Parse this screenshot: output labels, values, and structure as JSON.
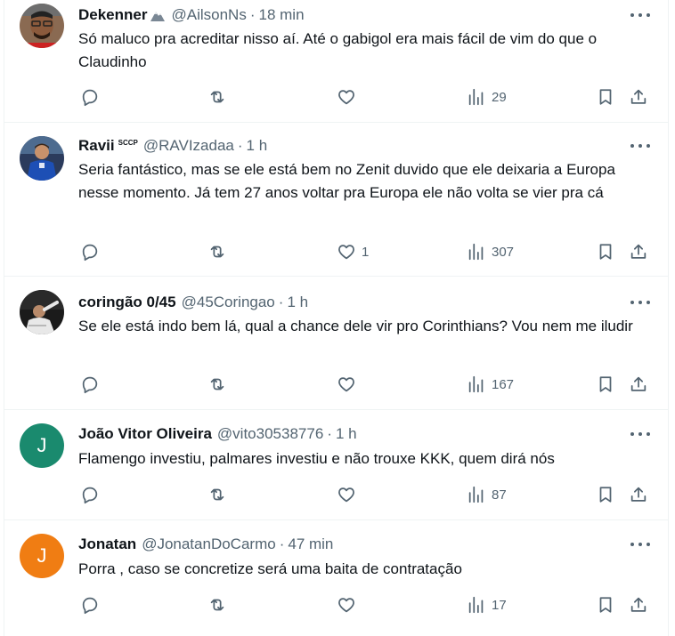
{
  "tweets": [
    {
      "name": "Dekenner",
      "badge": "",
      "handle": "@AilsonNs",
      "separator": "·",
      "time": "18 min",
      "text": "Só maluco pra acreditar nisso aí. Até o gabigol era mais fácil de vim do que o Claudinho",
      "likes": "",
      "views": "29",
      "avatar_letter": ""
    },
    {
      "name": "Ravii",
      "badge": "SCCP",
      "handle": "@RAVIzadaa",
      "separator": "·",
      "time": "1 h",
      "text": "Seria fantástico, mas se ele está bem no Zenit duvido que ele deixaria a Europa nesse momento. Já tem 27 anos voltar pra Europa ele não volta se vier pra cá",
      "likes": "1",
      "views": "307",
      "avatar_letter": ""
    },
    {
      "name": "coringão 0/45",
      "badge": "",
      "handle": "@45Coringao",
      "separator": "·",
      "time": "1 h",
      "text": "Se ele está indo bem lá, qual a chance dele vir pro Corinthians? Vou nem me iludir",
      "likes": "",
      "views": "167",
      "avatar_letter": ""
    },
    {
      "name": "João Vitor Oliveira",
      "badge": "",
      "handle": "@vito30538776",
      "separator": "·",
      "time": "1 h",
      "text": "Flamengo investiu, palmares investiu e não trouxe KKK, quem dirá nós",
      "likes": "",
      "views": "87",
      "avatar_letter": "J"
    },
    {
      "name": "Jonatan",
      "badge": "",
      "handle": "@JonatanDoCarmo",
      "separator": "·",
      "time": "47 min",
      "text": "Porra , caso se concretize será uma baita de contratação",
      "likes": "",
      "views": "17",
      "avatar_letter": "J"
    }
  ],
  "colors": {
    "text": "#0f1419",
    "secondary": "#536471",
    "border": "#eff3f4",
    "avatar_teal": "#1a8a6e",
    "avatar_orange": "#f07d13"
  },
  "icons": [
    "reply-icon",
    "retweet-icon",
    "like-icon",
    "views-icon",
    "bookmark-icon",
    "share-icon",
    "more-icon"
  ]
}
